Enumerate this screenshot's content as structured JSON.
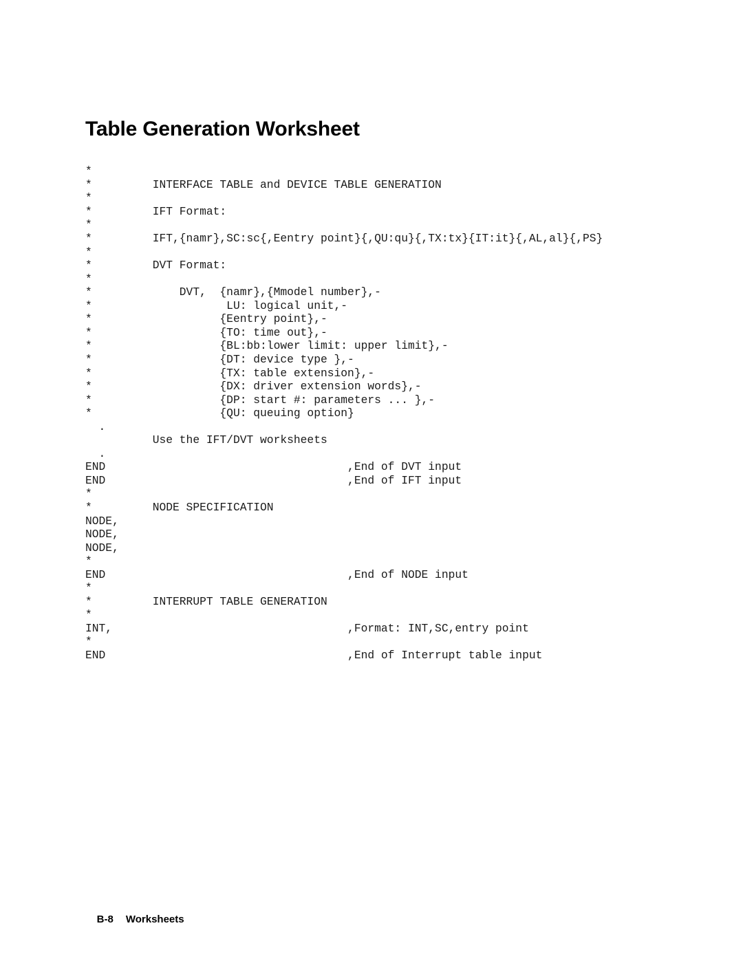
{
  "document": {
    "title": "Table Generation Worksheet",
    "footer": {
      "page_number": "B-8",
      "section_label": "Worksheets"
    }
  },
  "listing": {
    "comment_column": 40,
    "lines": [
      "*",
      "*         INTERFACE TABLE and DEVICE TABLE GENERATION",
      "*",
      "*         IFT Format:",
      "*",
      "*         IFT,{namr},SC:sc{,Eentry point}{,QU:qu}{,TX:tx}{IT:it}{,AL,al}{,PS}",
      "*",
      "*         DVT Format:",
      "*",
      "*             DVT,  {namr},{Mmodel number},-",
      "*                    LU: logical unit,-",
      "*                   {Eentry point},-",
      "*                   {TO: time out},-",
      "*                   {BL:bb:lower limit: upper limit},-",
      "*                   {DT: device type },-",
      "*                   {TX: table extension},-",
      "*                   {DX: driver extension words},-",
      "*                   {DP: start #: parameters ... },-",
      "*                   {QU: queuing option}",
      "  .",
      "          Use the IFT/DVT worksheets",
      "  .",
      "END                                    ,End of DVT input",
      "END                                    ,End of IFT input",
      "*",
      "*         NODE SPECIFICATION",
      "NODE,",
      "NODE,",
      "NODE,",
      "*",
      "END                                    ,End of NODE input",
      "*",
      "*         INTERRUPT TABLE GENERATION",
      "*",
      "INT,                                   ,Format: INT,SC,entry point",
      "*",
      "END                                    ,End of Interrupt table input"
    ]
  },
  "colors": {
    "page_background": "#ffffff",
    "title_text": "#000000",
    "listing_text": "#1a1a1a",
    "footer_text": "#000000"
  }
}
